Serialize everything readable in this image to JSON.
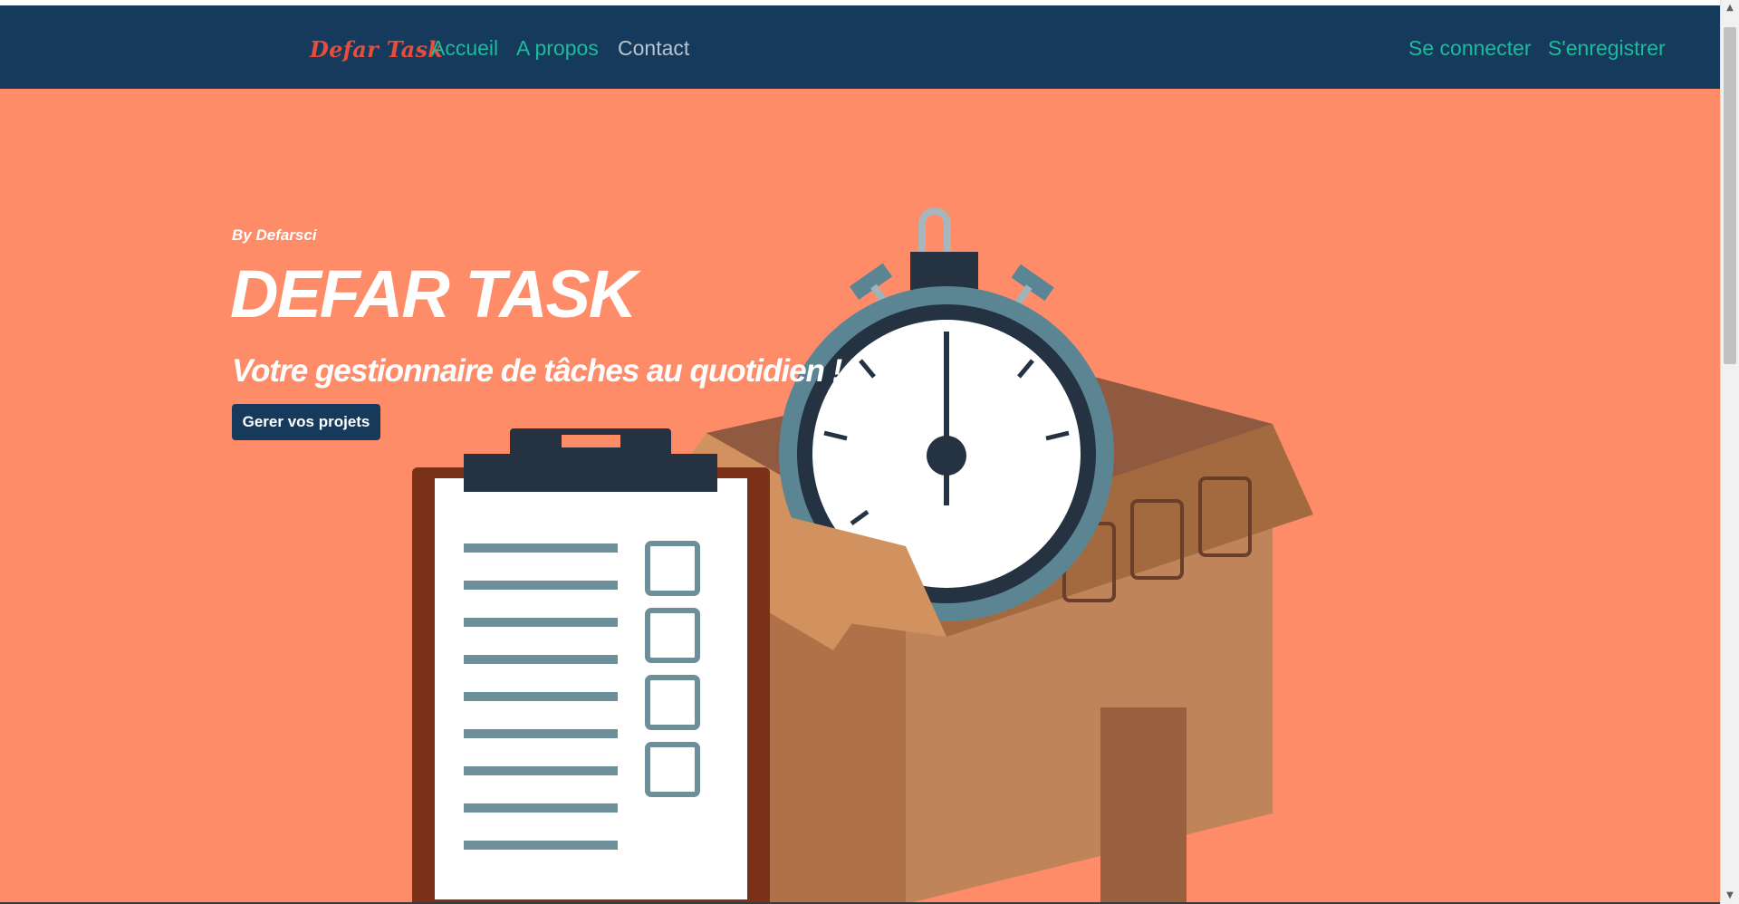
{
  "navbar": {
    "brand": "Defar Task",
    "links": [
      {
        "label": "Accueil"
      },
      {
        "label": "A propos"
      },
      {
        "label": "Contact"
      }
    ],
    "auth": {
      "login": "Se connecter",
      "register": "S'enregistrer"
    }
  },
  "hero": {
    "byline": "By Defarsci",
    "title": "DEFAR TASK",
    "subtitle": "Votre gestionnaire de tâches au quotidien !",
    "cta": "Gerer vos projets"
  },
  "colors": {
    "navbar_bg": "#163a5c",
    "hero_bg": "#ff8c69",
    "brand": "#e74c3c",
    "link": "#1abc9c"
  },
  "illustration": {
    "icons": [
      "clipboard-checklist-icon",
      "stopwatch-icon",
      "cardboard-box-icon"
    ]
  }
}
